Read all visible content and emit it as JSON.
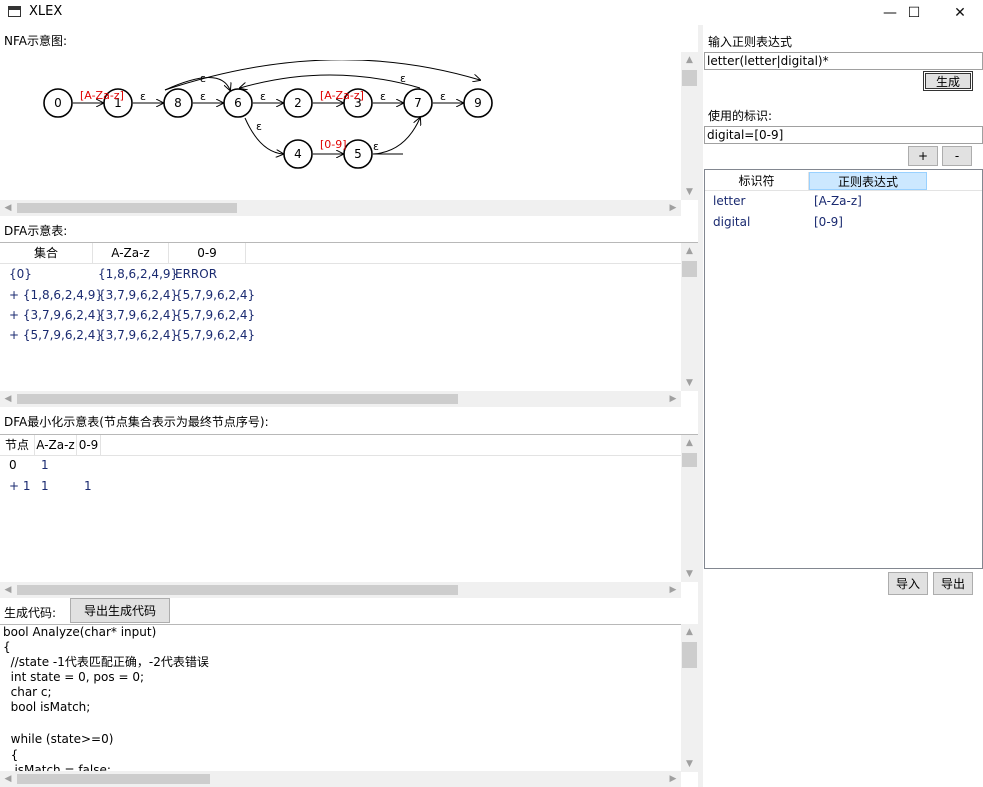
{
  "window": {
    "title": "XLEX",
    "minimize": "—",
    "maximize": "☐",
    "close": "✕"
  },
  "nfa": {
    "label": "NFA示意图:",
    "states": [
      "0",
      "1",
      "8",
      "6",
      "2",
      "3",
      "7",
      "9",
      "4",
      "5"
    ],
    "edge_labels": {
      "letter": "[A-Za-z]",
      "digit": "[0-9]",
      "epsilon": "ε"
    },
    "accent_color": "#e00000"
  },
  "dfa": {
    "label": "DFA示意表:",
    "headers": [
      "集合",
      "A-Za-z",
      "0-9"
    ],
    "rows": [
      [
        "{0}",
        "{1,8,6,2,4,9}",
        "ERROR"
      ],
      [
        "+ {1,8,6,2,4,9}",
        "{3,7,9,6,2,4}",
        "{5,7,9,6,2,4}"
      ],
      [
        "+ {3,7,9,6,2,4}",
        "{3,7,9,6,2,4}",
        "{5,7,9,6,2,4}"
      ],
      [
        "+ {5,7,9,6,2,4}",
        "{3,7,9,6,2,4}",
        "{5,7,9,6,2,4}"
      ]
    ]
  },
  "mindfa": {
    "label": "DFA最小化示意表(节点集合表示为最终节点序号):",
    "headers": [
      "节点",
      "A-Za-z",
      "0-9"
    ],
    "rows": [
      [
        "0",
        "1",
        ""
      ],
      [
        "+ 1",
        "1",
        "1"
      ]
    ]
  },
  "code": {
    "label": "生成代码:",
    "export_button": "导出生成代码",
    "lines": [
      "bool Analyze(char* input)",
      "{",
      "  //state -1代表匹配正确，-2代表错误",
      "  int state = 0, pos = 0;",
      "  char c;",
      "  bool isMatch;",
      "",
      "  while (state>=0)",
      "  {",
      "   isMatch = false;"
    ]
  },
  "right": {
    "regex_label": "输入正则表达式",
    "regex_value": "letter(letter|digital)*",
    "generate_button": "生成",
    "ident_label": "使用的标识:",
    "ident_value": "digital=[0-9]",
    "add_button": "+",
    "remove_button": "-",
    "table_headers": [
      "标识符",
      "正则表达式"
    ],
    "table_rows": [
      [
        "letter",
        "[A-Za-z]"
      ],
      [
        "digital",
        "[0-9]"
      ]
    ],
    "import_button": "导入",
    "export_button": "导出"
  },
  "colors": {
    "selected_header_bg": "#cce8ff",
    "selected_header_border": "#99d1ff",
    "table_text": "#1a2a70"
  }
}
